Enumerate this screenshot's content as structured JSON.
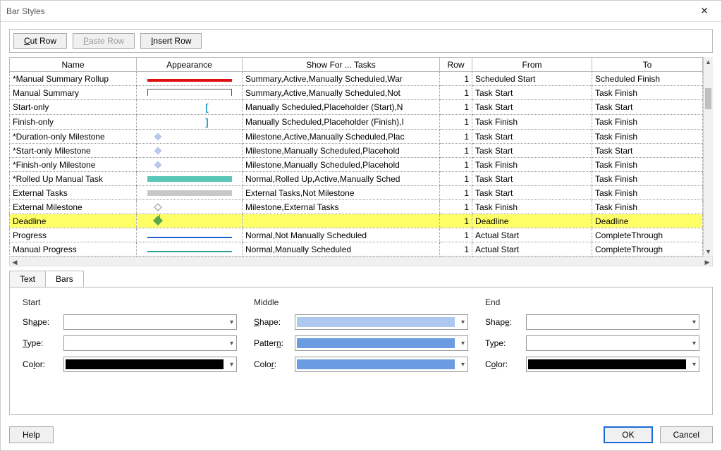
{
  "title": "Bar Styles",
  "toolbar": {
    "cut": "Cut Row",
    "paste": "Paste Row",
    "insert": "Insert Row"
  },
  "columns": {
    "name": "Name",
    "appearance": "Appearance",
    "show": "Show For ... Tasks",
    "row": "Row",
    "from": "From",
    "to": "To"
  },
  "rows": [
    {
      "name": "*Manual Summary Rollup",
      "app": "bar-red",
      "show": "Summary,Active,Manually Scheduled,War",
      "row": "1",
      "from": "Scheduled Start",
      "to": "Scheduled Finish"
    },
    {
      "name": "Manual Summary",
      "app": "bracket",
      "show": "Summary,Active,Manually Scheduled,Not",
      "row": "1",
      "from": "Task Start",
      "to": "Task Finish"
    },
    {
      "name": "Start-only",
      "app": "start-br",
      "show": "Manually Scheduled,Placeholder (Start),N",
      "row": "1",
      "from": "Task Start",
      "to": "Task Start"
    },
    {
      "name": "Finish-only",
      "app": "end-br",
      "show": "Manually Scheduled,Placeholder (Finish),I",
      "row": "1",
      "from": "Task Finish",
      "to": "Task Finish"
    },
    {
      "name": "*Duration-only Milestone",
      "app": "diamond",
      "show": "Milestone,Active,Manually Scheduled,Plac",
      "row": "1",
      "from": "Task Start",
      "to": "Task Finish"
    },
    {
      "name": "*Start-only Milestone",
      "app": "diamond",
      "show": "Milestone,Manually Scheduled,Placehold",
      "row": "1",
      "from": "Task Start",
      "to": "Task Start"
    },
    {
      "name": "*Finish-only Milestone",
      "app": "diamond",
      "show": "Milestone,Manually Scheduled,Placehold",
      "row": "1",
      "from": "Task Finish",
      "to": "Task Finish"
    },
    {
      "name": "*Rolled Up Manual Task",
      "app": "bar-teal",
      "show": "Normal,Rolled Up,Active,Manually Sched",
      "row": "1",
      "from": "Task Start",
      "to": "Task Finish"
    },
    {
      "name": "External Tasks",
      "app": "bar-gray",
      "show": "External Tasks,Not Milestone",
      "row": "1",
      "from": "Task Start",
      "to": "Task Finish"
    },
    {
      "name": "External Milestone",
      "app": "diamond-out",
      "show": "Milestone,External Tasks",
      "row": "1",
      "from": "Task Finish",
      "to": "Task Finish"
    },
    {
      "name": "Deadline",
      "app": "diamond-g",
      "show": "",
      "row": "1",
      "from": "Deadline",
      "to": "Deadline",
      "selected": true
    },
    {
      "name": "Progress",
      "app": "line-blue",
      "show": "Normal,Not Manually Scheduled",
      "row": "1",
      "from": "Actual Start",
      "to": "CompleteThrough"
    },
    {
      "name": "Manual Progress",
      "app": "line-teal",
      "show": "Normal,Manually Scheduled",
      "row": "1",
      "from": "Actual Start",
      "to": "CompleteThrough"
    }
  ],
  "tabs": {
    "text": "Text",
    "bars": "Bars"
  },
  "groups": {
    "start": "Start",
    "middle": "Middle",
    "end": "End",
    "shape": "Shape:",
    "type": "Type:",
    "pattern": "Pattern:",
    "color": "Color:"
  },
  "footer": {
    "help": "Help",
    "ok": "OK",
    "cancel": "Cancel"
  }
}
